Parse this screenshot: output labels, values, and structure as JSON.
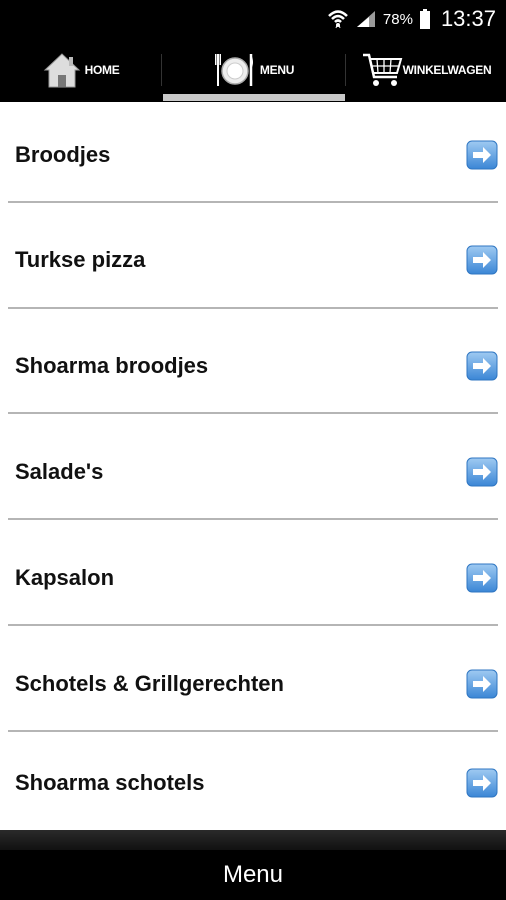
{
  "status": {
    "battery": "78%",
    "time": "13:37"
  },
  "tabs": [
    {
      "label": "HOME",
      "icon": "house-icon"
    },
    {
      "label": "MENU",
      "icon": "plate-icon",
      "active": true
    },
    {
      "label": "WINKELWAGEN",
      "icon": "shopping-cart-icon"
    }
  ],
  "menu_items": [
    {
      "label": "Broodjes"
    },
    {
      "label": "Turkse pizza"
    },
    {
      "label": "Shoarma broodjes"
    },
    {
      "label": "Salade's"
    },
    {
      "label": "Kapsalon"
    },
    {
      "label": "Schotels & Grillgerechten"
    },
    {
      "label": "Shoarma schotels"
    }
  ],
  "arrow_icon": "arrow-right-icon",
  "footer": {
    "title": "Menu"
  },
  "colors": {
    "accent": "#4a90d9",
    "background": "#000000",
    "list": "#ffffff"
  }
}
